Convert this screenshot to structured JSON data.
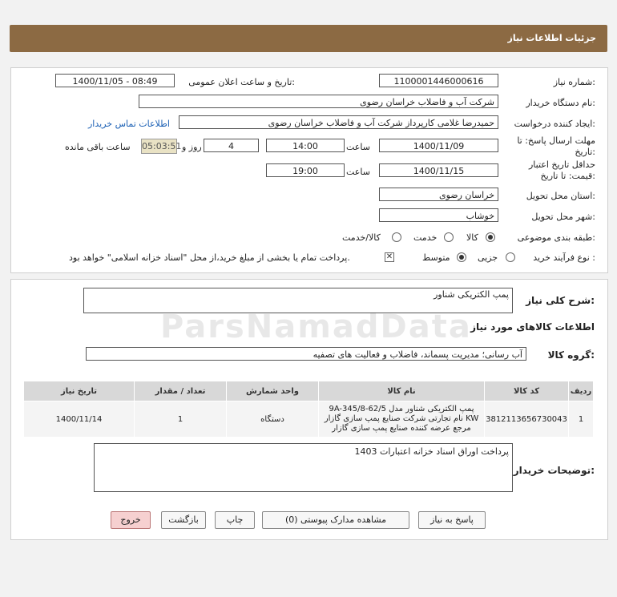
{
  "header": {
    "title": "جزئیات اطلاعات نیاز"
  },
  "form": {
    "need_number_label": "شماره نیاز:",
    "need_number": "1100001446000616",
    "announce_label": "تاریخ و ساعت اعلان عمومی:",
    "announce_value": "1400/11/05 - 08:49",
    "buyer_label": "نام دستگاه خریدار:",
    "buyer_value": "شرکت آب و فاضلاب خراسان رضوی",
    "creator_label": "ایجاد کننده درخواست:",
    "creator_value": "حمیدرضا غلامی کارپرداز شرکت آب و فاضلاب خراسان رضوی",
    "contact_link": "اطلاعات تماس خریدار",
    "deadline_label_1": "مهلت ارسال پاسخ: تا",
    "deadline_label_2": "تاریخ:",
    "deadline_date": "1400/11/09",
    "time_label": "ساعت",
    "deadline_time": "14:00",
    "days_value": "4",
    "days_label": "روز و",
    "remaining_value": "05:03:51",
    "remaining_label": "ساعت باقی مانده",
    "validity_label_1": "حداقل تاریخ اعتبار",
    "validity_label_2": "قیمت: تا تاریخ:",
    "validity_date": "1400/11/15",
    "validity_time": "19:00",
    "province_label": "استان محل تحویل:",
    "province_value": "خراسان رضوی",
    "city_label": "شهر محل تحویل:",
    "city_value": "خوشاب",
    "category_label": "طبقه بندی موضوعی:",
    "category_options": [
      "کالا",
      "خدمت",
      "کالا/خدمت"
    ],
    "process_label": "نوع فرآیند خرید :",
    "process_options": [
      "جزیی",
      "متوسط"
    ],
    "payment_note": "پرداخت تمام یا بخشی از مبلغ خرید،از محل \"اسناد خزانه اسلامی\" خواهد بود."
  },
  "details": {
    "summary_label": "شرح کلی نیاز:",
    "summary_value": "پمپ الکتریکی شناور",
    "goods_info_title": "اطلاعات کالاهای مورد نیاز",
    "group_label": "گروه کالا:",
    "group_value": "آب رسانی؛ مدیریت پسماند، فاضلاب و فعالیت های تصفیه",
    "table": {
      "headers": [
        "ردیف",
        "کد کالا",
        "نام کالا",
        "واحد شمارش",
        "تعداد / مقدار",
        "تاریخ نیاز"
      ],
      "rows": [
        {
          "row": "1",
          "code": "3812113656730043",
          "name": "پمپ الکتریکی شناور مدل 9A-345/8-62/5 KW نام تجارتی شرکت صنایع پمپ سازی گازار مرجع عرضه کننده صنایع پمپ سازی گازار",
          "unit": "دستگاه",
          "qty": "1",
          "date": "1400/11/14"
        }
      ]
    },
    "buyer_notes_label": "توضیحات خریدار:",
    "buyer_notes_value": "پرداخت اوراق اسناد خزانه اعتبارات 1403"
  },
  "buttons": {
    "reply": "پاسخ به نیاز",
    "docs": "مشاهده مدارک پیوستی (0)",
    "print": "چاپ",
    "back": "بازگشت",
    "exit": "خروج"
  },
  "colors": {
    "header": "#8c6a43",
    "exit_button": "#f6d0d0"
  }
}
